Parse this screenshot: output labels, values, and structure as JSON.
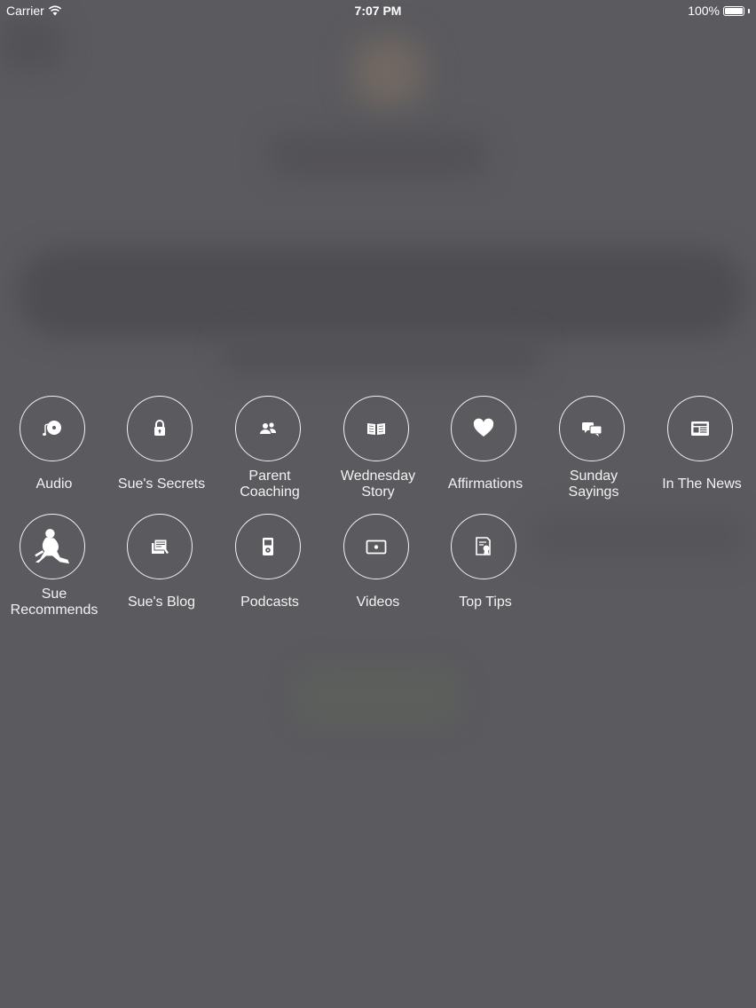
{
  "status_bar": {
    "carrier": "Carrier",
    "time": "7:07 PM",
    "battery": "100%",
    "icons": [
      "wifi-icon",
      "battery-icon"
    ]
  },
  "menu": {
    "items": [
      {
        "label": "Audio",
        "icon": "audio-disc-icon"
      },
      {
        "label": "Sue's Secrets",
        "icon": "padlock-icon"
      },
      {
        "label": "Parent\nCoaching",
        "icon": "people-icon"
      },
      {
        "label": "Wednesday\nStory",
        "icon": "open-book-icon"
      },
      {
        "label": "Affirmations",
        "icon": "heart-icon"
      },
      {
        "label": "Sunday\nSayings",
        "icon": "speech-bubbles-icon"
      },
      {
        "label": "In The News",
        "icon": "newspaper-icon"
      },
      {
        "label": "Sue\nRecommends",
        "icon": "sitting-woman-icon"
      },
      {
        "label": "Sue's Blog",
        "icon": "blog-icon"
      },
      {
        "label": "Podcasts",
        "icon": "ipod-icon"
      },
      {
        "label": "Videos",
        "icon": "video-icon"
      },
      {
        "label": "Top Tips",
        "icon": "certificate-icon"
      }
    ]
  },
  "colors": {
    "overlay": "#5b5a5e",
    "ring": "#ffffff",
    "text": "#f2f2f2"
  }
}
